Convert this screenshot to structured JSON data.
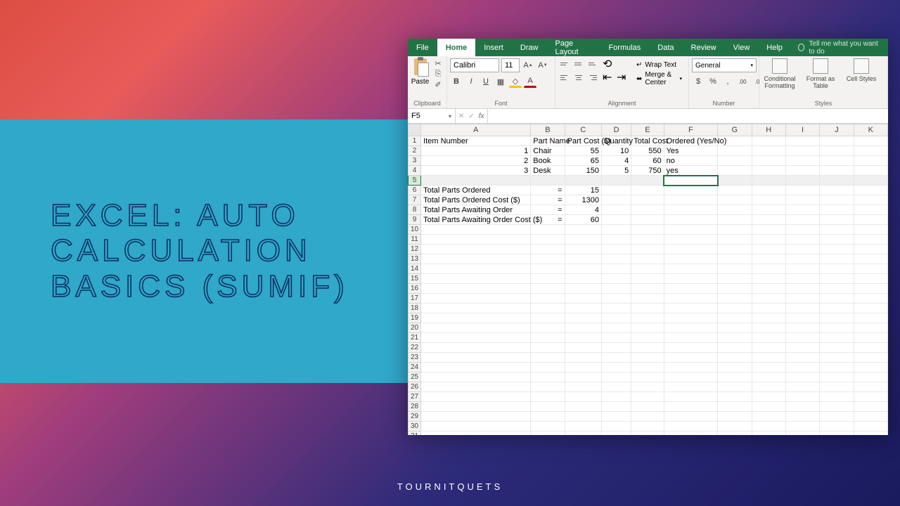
{
  "overlay": {
    "title": "EXCEL: AUTO CALCULATION BASICS (SUMIF)",
    "footer": "TOURNITQUETS"
  },
  "ribbon": {
    "tabs": [
      "File",
      "Home",
      "Insert",
      "Draw",
      "Page Layout",
      "Formulas",
      "Data",
      "Review",
      "View",
      "Help"
    ],
    "active_tab": "Home",
    "tell_me": "Tell me what you want to do",
    "clipboard": {
      "paste": "Paste",
      "label": "Clipboard"
    },
    "font": {
      "name": "Calibri",
      "size": "11",
      "label": "Font",
      "bold": "B",
      "italic": "I",
      "underline": "U"
    },
    "alignment": {
      "label": "Alignment",
      "wrap": "Wrap Text",
      "merge": "Merge & Center"
    },
    "number": {
      "label": "Number",
      "format": "General"
    },
    "styles": {
      "label": "Styles",
      "cond": "Conditional Formatting",
      "table": "Format as Table",
      "cell": "Cell Styles"
    }
  },
  "formula_bar": {
    "cell_ref": "F5",
    "formula": ""
  },
  "columns": [
    "A",
    "B",
    "C",
    "D",
    "E",
    "F",
    "G",
    "H",
    "I",
    "J",
    "K"
  ],
  "headers": {
    "A": "Item Number",
    "B": "Part Name",
    "C": "Part Cost ($)",
    "D": "Quantity",
    "E": "Total Cost",
    "F": "Ordered (Yes/No)"
  },
  "rows": [
    {
      "A": "1",
      "B": "Chair",
      "C": "55",
      "D": "10",
      "E": "550",
      "F": "Yes"
    },
    {
      "A": "2",
      "B": "Book",
      "C": "65",
      "D": "4",
      "E": "60",
      "F": "no"
    },
    {
      "A": "3",
      "B": "Desk",
      "C": "150",
      "D": "5",
      "E": "750",
      "F": "yes"
    }
  ],
  "summary": [
    {
      "label": "Total Parts Ordered",
      "eq": "=",
      "val": "15"
    },
    {
      "label": "Total Parts Ordered Cost ($)",
      "eq": "=",
      "val": "1300"
    },
    {
      "label": "Total Parts Awaiting Order",
      "eq": "=",
      "val": "4"
    },
    {
      "label": "Total Parts Awaiting Order Cost ($)",
      "eq": "=",
      "val": "60"
    }
  ],
  "selected_cell": "F5",
  "row_count": 32
}
